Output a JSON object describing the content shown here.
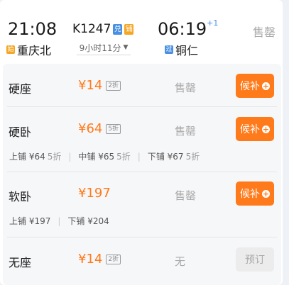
{
  "header": {
    "dep_time": "21:08",
    "dep_tag": "始",
    "dep_station": "重庆北",
    "train_no": "K1247",
    "badge_exchange": "兑",
    "badge_sleeper": "铺",
    "duration": "9小时11分",
    "arr_time": "06:19",
    "arr_offset": "+1",
    "arr_tag": "过",
    "arr_station": "铜仁",
    "status": "售罄"
  },
  "seats": [
    {
      "name": "硬座",
      "price": "¥14",
      "discount": "2折",
      "status": "售罄",
      "button": "候补"
    },
    {
      "name": "硬卧",
      "price": "¥64",
      "discount": "5折",
      "status": "售罄",
      "button": "候补",
      "berths": [
        {
          "label": "上铺 ¥64",
          "disc": "5折"
        },
        {
          "label": "中铺 ¥65",
          "disc": "5折"
        },
        {
          "label": "下铺 ¥67",
          "disc": "5折"
        }
      ]
    },
    {
      "name": "软卧",
      "price": "¥197",
      "status": "售罄",
      "button": "候补",
      "berths": [
        {
          "label": "上铺 ¥197"
        },
        {
          "label": "下铺 ¥204"
        }
      ]
    },
    {
      "name": "无座",
      "price": "¥14",
      "discount": "2折",
      "status": "无",
      "button": "预订"
    }
  ],
  "colors": {
    "accent": "#ff7a1a",
    "start_tag": "#f5a623",
    "pass_tag": "#4a90e2",
    "exchange_badge": "#4a90e2",
    "sleeper_badge": "#f5a623"
  },
  "icons": {
    "waitlist_icon": "plus-circle-icon",
    "duration_icon": "chevron-down-icon"
  }
}
